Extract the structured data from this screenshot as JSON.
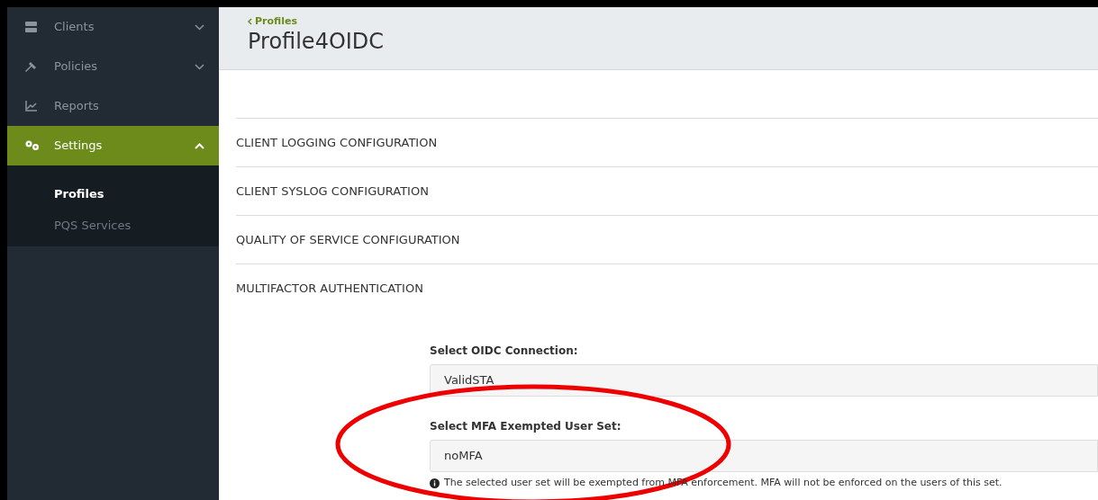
{
  "sidebar": {
    "items": [
      {
        "label": "Clients",
        "kind": "group",
        "expanded": false,
        "selected": false
      },
      {
        "label": "Policies",
        "kind": "group",
        "expanded": false,
        "selected": false
      },
      {
        "label": "Reports",
        "kind": "link",
        "selected": false
      },
      {
        "label": "Settings",
        "kind": "group",
        "expanded": true,
        "selected": true,
        "children": [
          {
            "label": "Profiles",
            "selected": true
          },
          {
            "label": "PQS Services",
            "selected": false
          }
        ]
      }
    ]
  },
  "header": {
    "breadcrumb": "Profiles",
    "title": "Profile4OIDC"
  },
  "sections": [
    "CLIENT LOGGING CONFIGURATION",
    "CLIENT SYSLOG CONFIGURATION",
    "QUALITY OF SERVICE CONFIGURATION",
    "MULTIFACTOR AUTHENTICATION"
  ],
  "form": {
    "fields": [
      {
        "label": "Select OIDC Connection:",
        "value": "ValidSTA"
      },
      {
        "label": "Select MFA Exempted User Set:",
        "value": "noMFA",
        "help": "The selected user set will be exempted from MFA enforcement. MFA will not be enforced on the users of this set."
      }
    ]
  },
  "annotation": {
    "kind": "ellipse",
    "color": "#ee0000"
  }
}
